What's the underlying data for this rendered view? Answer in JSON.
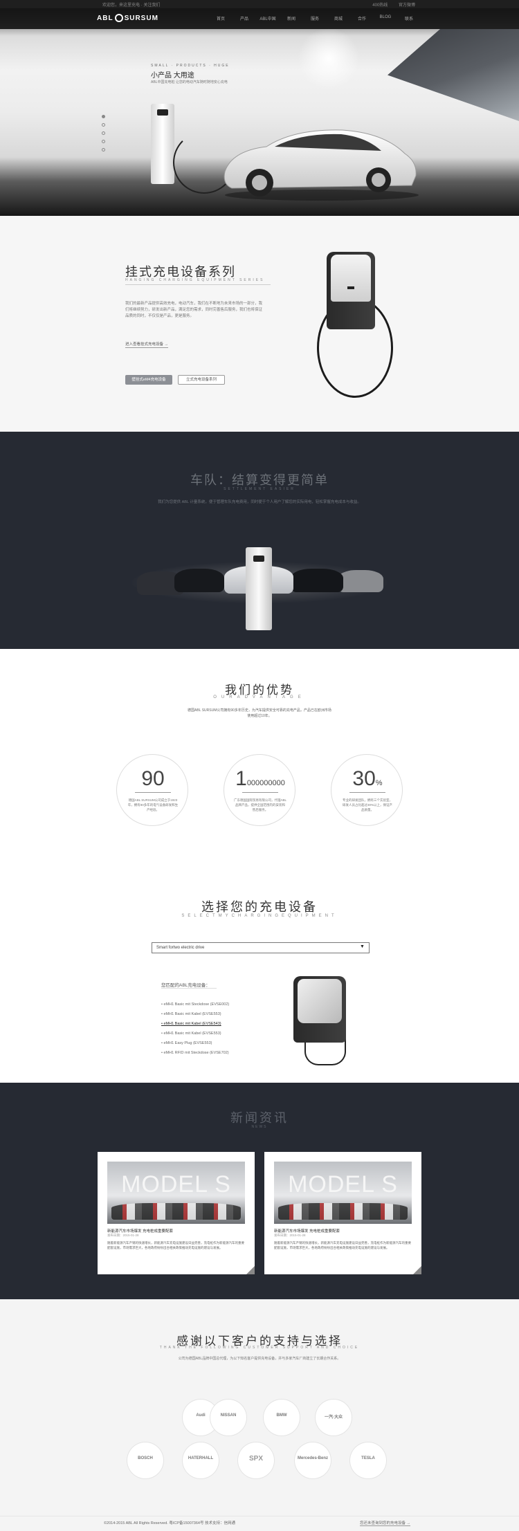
{
  "topbar": {
    "left_text": "欢迎您，来这里充电 · 关注我们",
    "right_items": [
      "400热线",
      "官方微博"
    ]
  },
  "header": {
    "logo_left": "ABL",
    "logo_right": "SURSUM",
    "menu": [
      "首页",
      "产品",
      "ABL中国",
      "新闻",
      "服务",
      "商城",
      "合作",
      "BLOG",
      "联系"
    ]
  },
  "hero": {
    "kicker": "SMALL · PRODUCTS · HUGE",
    "title": "小产品 大用途",
    "subtitle": "ABL中国充电桩 让您的电动汽车随时随地安心充电"
  },
  "hanging": {
    "title": "挂式充电设备系列",
    "subtitle_en": "HANGING CHARGING EQUIPMENT SERIES",
    "description": "我们的最新产品提供高效充电，电动汽车，我们在不断地为未来市场的一部分，我们将继续努力，研发出新产品，满足您的需求，同时完善售后服务，我们也将保证品质的同时，不仅仅是产品，更是服务。",
    "link": "进入查看挂式充电设备 →",
    "button_primary": "壁挂式eM4充电设备",
    "button_secondary": "立式充电设备系列"
  },
  "fleet": {
    "title": "车队：结算变得更简单",
    "subtitle_en": "SETTLEMENT EASIER",
    "description": "我们为您提供 ABL 计量系统，便于管理车队充电费用，同时便于个人用户了解您的实际用电，轻松掌握充电成本与收益。"
  },
  "advantage": {
    "title": "我们的优势",
    "subtitle_en": "OURADVANTAGE",
    "description": "德国ABL SURSUM公司拥有90多年历史，为汽车提供安全可靠的充电产品，产品已在欧洲市场使用超过10年。",
    "items": [
      {
        "value": "90",
        "suffix": "",
        "text": "德国ABL SURSUM公司成立于1923年，拥有90多年的电气设备研发和生产经验。"
      },
      {
        "value": "1",
        "suffix": "000000000",
        "text": "广东德国国际贸易有限公司，代理ABL品牌产品，提供全国范围内的安装和售后服务。"
      },
      {
        "value": "30",
        "suffix": "%",
        "text": "专业的研发团队，拥有三个实验室，研发人员占比超过30%以上，保证产品质量。"
      }
    ]
  },
  "selector": {
    "title": "选择您的充电设备",
    "subtitle_en": "SELECTMYCHARGINGEQUIPMENT",
    "select_value": "Smart fortwo electric drive",
    "arrow": "▼",
    "matched_heading": "您匹配的ABL充电设备：",
    "items": [
      {
        "label": "eMH1 Basic mit Steckdose (EVSE002)",
        "active": false
      },
      {
        "label": "eMH1 Basic mit Kabel (EVSE553)",
        "active": false
      },
      {
        "label": "eMH1 Basic mit Kabel (EVSE543)",
        "active": true
      },
      {
        "label": "eMH1 Basic mit Kabel (EVSE553)",
        "active": false
      },
      {
        "label": "eMH1 Easy Plug (EVSE553)",
        "active": false
      },
      {
        "label": "eMH1 RFID mit Steckdose (EVSE702)",
        "active": false
      }
    ]
  },
  "news": {
    "title": "新闻资讯",
    "subtitle_en": "NEWS",
    "cards": [
      {
        "image_text": "MODEL S",
        "title": "新能源汽车市场爆发 充电桩成重要配套",
        "date": "发布日期：2015-01-28",
        "summary": "随着新能源汽车产销的快速增长，新能源汽车充电设施建设日益完善，充电桩作为新能源汽车的重要配套设施，市场需求巨大，各地政府纷纷出台相关政策推动充电设施的建设与发展。"
      },
      {
        "image_text": "MODEL S",
        "title": "新能源汽车市场爆发 充电桩成重要配套",
        "date": "发布日期：2015-01-28",
        "summary": "随着新能源汽车产销的快速增长，新能源汽车充电设施建设日益完善，充电桩作为新能源汽车的重要配套设施，市场需求巨大，各地政府纷纷出台相关政策推动充电设施的建设与发展。"
      }
    ]
  },
  "clients": {
    "title": "感谢以下客户的支持与选择",
    "subtitle_en": "THANK THE FOLLOWING CUSTOMER SUPPORT AND CHOICE",
    "description": "公司为德国ABL品牌中国总代理，为以下知名客户提供充电设备，并与多家汽车厂商建立了长期合作关系。",
    "logos": [
      "Audi",
      "NISSAN",
      "BMW",
      "一汽·大众",
      "BOSCH",
      "HATERHALL",
      "SPX",
      "Mercedes-Benz",
      "TESLA"
    ]
  },
  "footer": {
    "copyright": "©2014-2015 ABL All Rights Reserved. 粤ICP备15007364号  技术支持：信网通",
    "right_link": "您还未查询到您的充电设备 →"
  }
}
